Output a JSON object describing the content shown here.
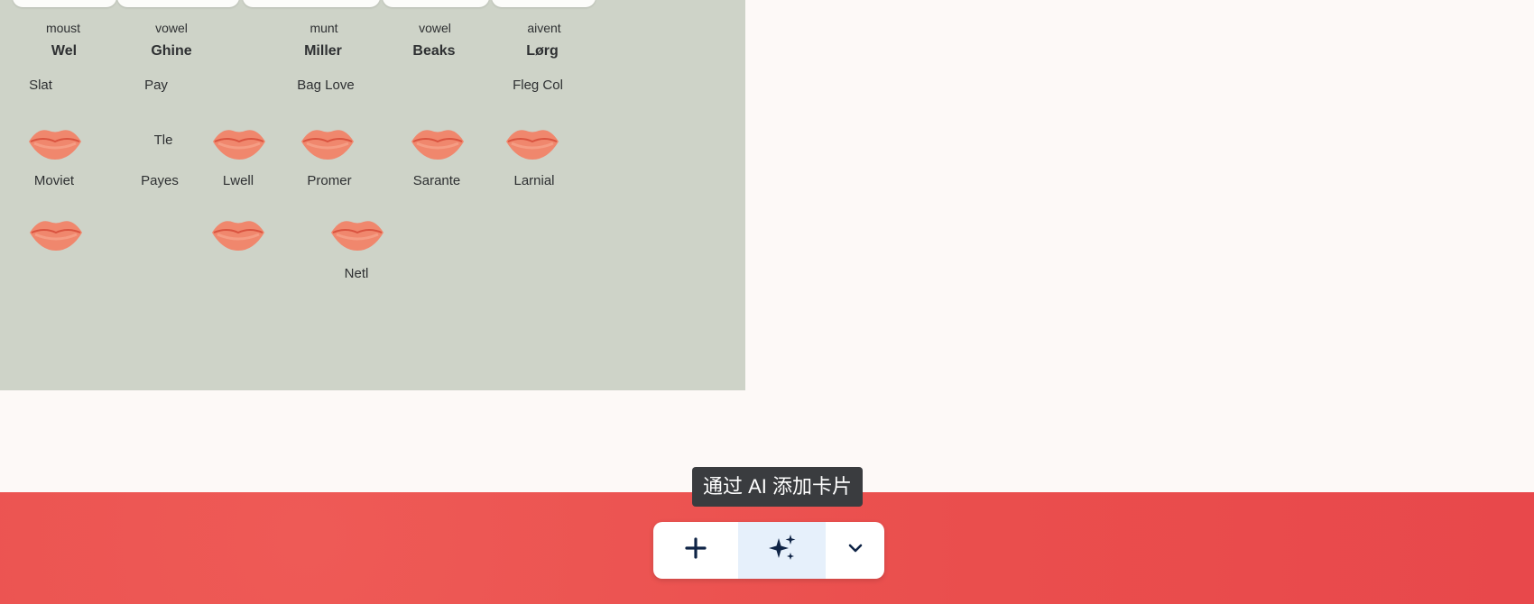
{
  "card_image": {
    "background": "#ced3c8",
    "top_labels": [
      "moust",
      "vowel",
      "munt",
      "vowel",
      "aivent"
    ],
    "headwords": [
      "Wel",
      "Ghine",
      "Miller",
      "Beaks",
      "Lørg"
    ],
    "row1_labels": [
      "Slat",
      "Pay",
      "Bag Love",
      "Fleg Col"
    ],
    "mid_label": "Tle",
    "row2_labels": [
      "Moviet",
      "Payes",
      "Lwell",
      "Promer",
      "Sarante",
      "Larnial"
    ],
    "bottom_label": "Netl"
  },
  "tooltip": {
    "text": "通过 AI 添加卡片"
  },
  "toolbar": {
    "add_icon": "plus-icon",
    "ai_icon": "sparkles-icon",
    "more_icon": "chevron-down-icon",
    "active_bg": "#e6f0fb",
    "icon_color": "#0f2446"
  },
  "colors": {
    "page_bg": "#fdf9f7",
    "band": "#ea4e4d",
    "lips": "#f0876d"
  }
}
